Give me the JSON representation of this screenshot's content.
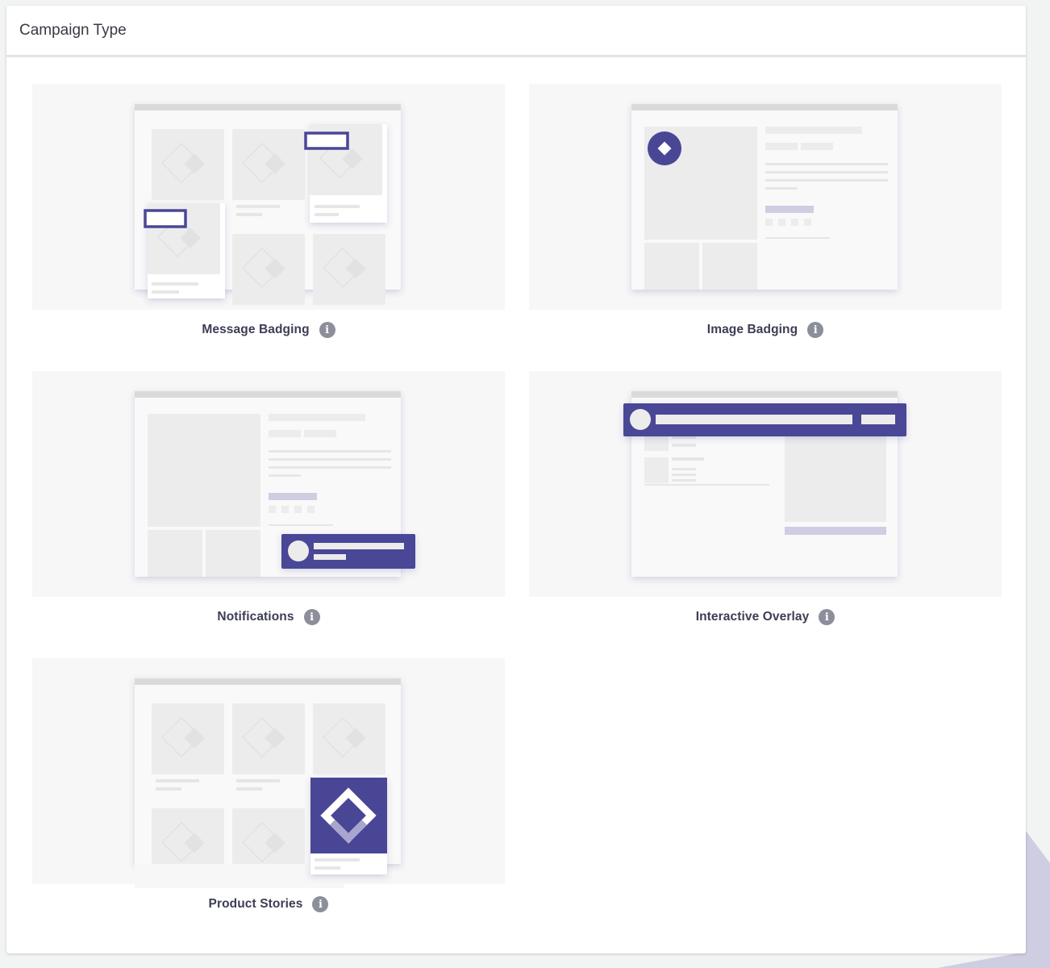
{
  "panel": {
    "title": "Campaign Type"
  },
  "colors": {
    "accent": "#4a4696",
    "preview_bg": "#f7f7f7",
    "placeholder": "#ececec",
    "info_icon": "#8d8e9c"
  },
  "campaign_types": [
    {
      "label": "Message Badging",
      "info_icon": "i",
      "preview": "message-badging"
    },
    {
      "label": "Image Badging",
      "info_icon": "i",
      "preview": "image-badging"
    },
    {
      "label": "Notifications",
      "info_icon": "i",
      "preview": "notifications"
    },
    {
      "label": "Interactive Overlay",
      "info_icon": "i",
      "preview": "interactive-overlay"
    },
    {
      "label": "Product Stories",
      "info_icon": "i",
      "preview": "product-stories"
    }
  ]
}
